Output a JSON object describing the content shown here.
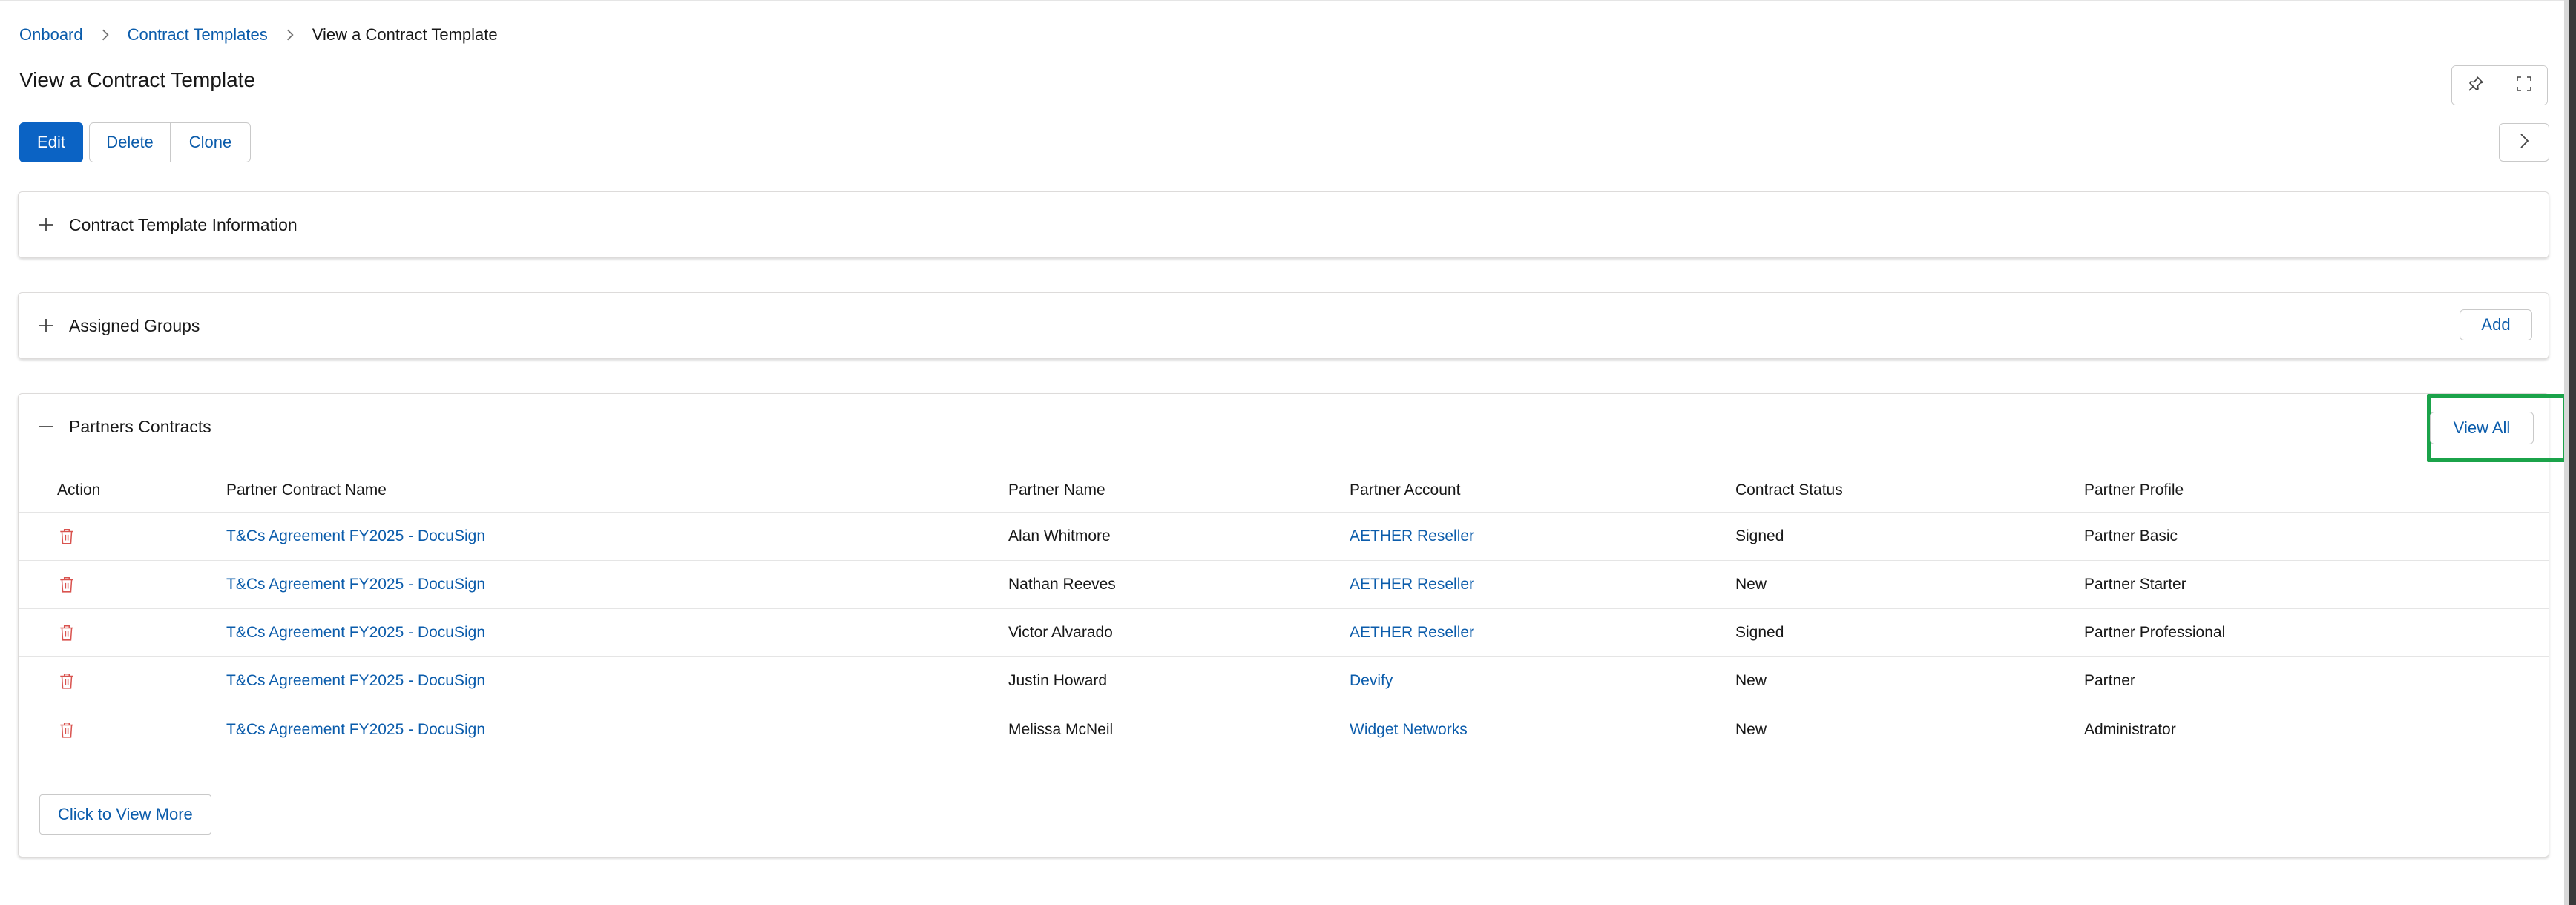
{
  "breadcrumb": {
    "items": [
      "Onboard",
      "Contract Templates"
    ],
    "current": "View a Contract Template"
  },
  "page": {
    "title": "View a Contract Template"
  },
  "toolbar": {
    "edit": "Edit",
    "delete": "Delete",
    "clone": "Clone"
  },
  "icons": {
    "pin": "pin-icon",
    "expand": "expand-icon",
    "next": "chevron-right-icon"
  },
  "sections": {
    "info": {
      "title": "Contract Template Information"
    },
    "groups": {
      "title": "Assigned Groups",
      "add": "Add"
    },
    "contracts": {
      "title": "Partners Contracts",
      "view_all": "View All",
      "view_more": "Click to View More",
      "columns": [
        "Action",
        "Partner Contract Name",
        "Partner Name",
        "Partner Account",
        "Contract Status",
        "Partner Profile"
      ],
      "rows": [
        {
          "name": "T&Cs Agreement FY2025 - DocuSign",
          "partner": "Alan Whitmore",
          "account": "AETHER Reseller",
          "status": "Signed",
          "profile": "Partner Basic"
        },
        {
          "name": "T&Cs Agreement FY2025 - DocuSign",
          "partner": "Nathan Reeves",
          "account": "AETHER Reseller",
          "status": "New",
          "profile": "Partner Starter"
        },
        {
          "name": "T&Cs Agreement FY2025 - DocuSign",
          "partner": "Victor Alvarado",
          "account": "AETHER Reseller",
          "status": "Signed",
          "profile": "Partner Professional"
        },
        {
          "name": "T&Cs Agreement FY2025 - DocuSign",
          "partner": "Justin Howard",
          "account": "Devify",
          "status": "New",
          "profile": "Partner"
        },
        {
          "name": "T&Cs Agreement FY2025 - DocuSign",
          "partner": "Melissa McNeil",
          "account": "Widget Networks",
          "status": "New",
          "profile": "Administrator"
        }
      ]
    }
  },
  "colors": {
    "link": "#0b5cab",
    "primary": "#0b63c4",
    "highlight": "#1ba34a",
    "trash": "#d9534f"
  }
}
